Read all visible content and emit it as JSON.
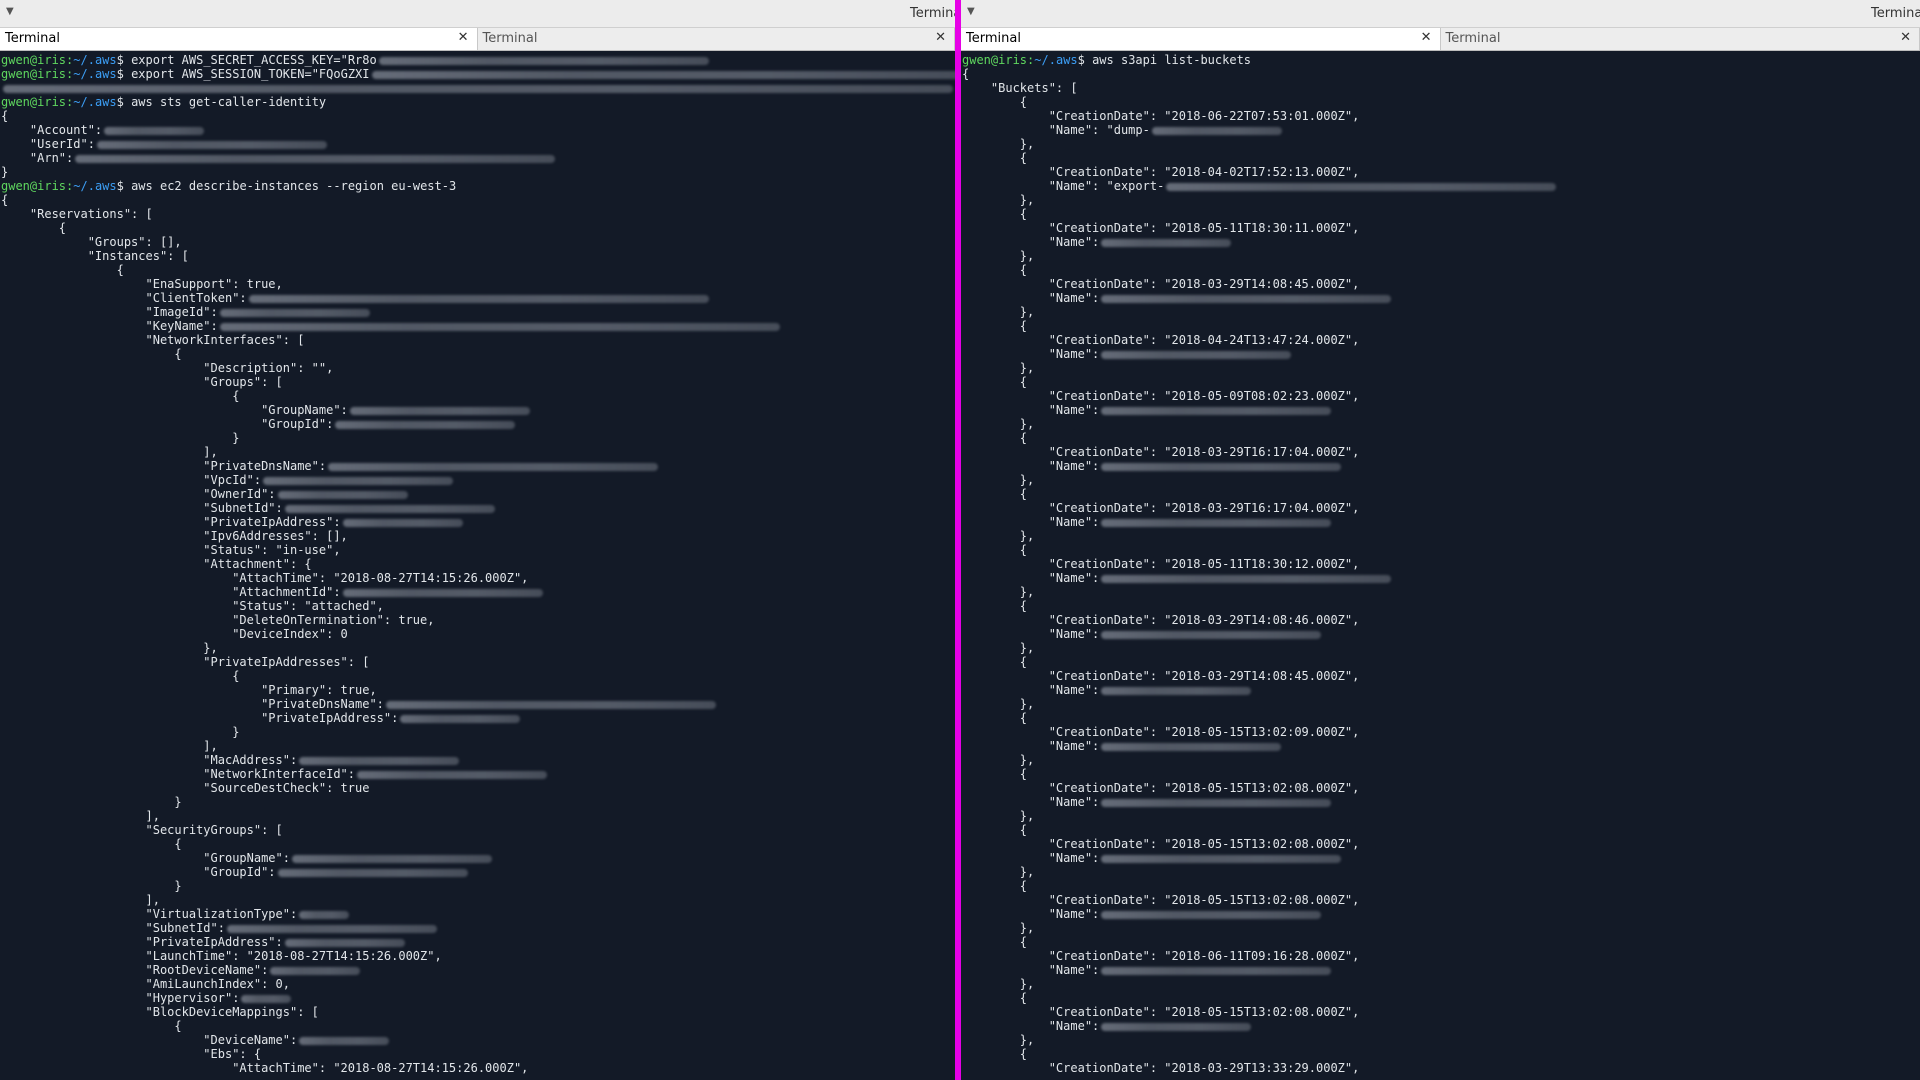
{
  "window": {
    "title": "Terminal"
  },
  "left_pane": {
    "tabs": [
      {
        "label": "Terminal",
        "close": "✕",
        "active": true
      },
      {
        "label": "Terminal",
        "close": "✕",
        "active": false
      }
    ],
    "lines": [
      {
        "kind": "prompt",
        "user": "gwen@iris",
        "path": "~/.aws",
        "cmd": "export AWS_SECRET_ACCESS_KEY=\"Rr8o",
        "blur": 330
      },
      {
        "kind": "prompt",
        "user": "gwen@iris",
        "path": "~/.aws",
        "cmd": "export AWS_SESSION_TOKEN=\"FQoGZXI",
        "blur": 590
      },
      {
        "kind": "text",
        "text": "",
        "blur": 950
      },
      {
        "kind": "prompt",
        "user": "gwen@iris",
        "path": "~/.aws",
        "cmd": "aws sts get-caller-identity"
      },
      {
        "kind": "text",
        "text": "{"
      },
      {
        "kind": "text",
        "text": "    \"Account\":",
        "blur": 100
      },
      {
        "kind": "text",
        "text": "    \"UserId\":",
        "blur": 230
      },
      {
        "kind": "text",
        "text": "    \"Arn\":",
        "blur": 480
      },
      {
        "kind": "text",
        "text": "}"
      },
      {
        "kind": "prompt",
        "user": "gwen@iris",
        "path": "~/.aws",
        "cmd": "aws ec2 describe-instances --region eu-west-3"
      },
      {
        "kind": "text",
        "text": "{"
      },
      {
        "kind": "text",
        "text": "    \"Reservations\": ["
      },
      {
        "kind": "text",
        "text": "        {"
      },
      {
        "kind": "text",
        "text": "            \"Groups\": [],"
      },
      {
        "kind": "text",
        "text": "            \"Instances\": ["
      },
      {
        "kind": "text",
        "text": "                {"
      },
      {
        "kind": "text",
        "text": "                    \"EnaSupport\": true,"
      },
      {
        "kind": "text",
        "text": "                    \"ClientToken\":",
        "blur": 460
      },
      {
        "kind": "text",
        "text": "                    \"ImageId\":",
        "blur": 150
      },
      {
        "kind": "text",
        "text": "                    \"KeyName\":",
        "blur": 560
      },
      {
        "kind": "text",
        "text": "                    \"NetworkInterfaces\": ["
      },
      {
        "kind": "text",
        "text": "                        {"
      },
      {
        "kind": "text",
        "text": "                            \"Description\": \"\","
      },
      {
        "kind": "text",
        "text": "                            \"Groups\": ["
      },
      {
        "kind": "text",
        "text": "                                {"
      },
      {
        "kind": "text",
        "text": "                                    \"GroupName\":",
        "blur": 180
      },
      {
        "kind": "text",
        "text": "                                    \"GroupId\":",
        "blur": 180
      },
      {
        "kind": "text",
        "text": "                                }"
      },
      {
        "kind": "text",
        "text": "                            ],"
      },
      {
        "kind": "text",
        "text": "                            \"PrivateDnsName\":",
        "blur": 330
      },
      {
        "kind": "text",
        "text": "                            \"VpcId\":",
        "blur": 190
      },
      {
        "kind": "text",
        "text": "                            \"OwnerId\":",
        "blur": 130
      },
      {
        "kind": "text",
        "text": "                            \"SubnetId\":",
        "blur": 210
      },
      {
        "kind": "text",
        "text": "                            \"PrivateIpAddress\":",
        "blur": 120
      },
      {
        "kind": "text",
        "text": "                            \"Ipv6Addresses\": [],"
      },
      {
        "kind": "text",
        "text": "                            \"Status\": \"in-use\","
      },
      {
        "kind": "text",
        "text": "                            \"Attachment\": {"
      },
      {
        "kind": "text",
        "text": "                                \"AttachTime\": \"2018-08-27T14:15:26.000Z\","
      },
      {
        "kind": "text",
        "text": "                                \"AttachmentId\":",
        "blur": 200
      },
      {
        "kind": "text",
        "text": "                                \"Status\": \"attached\","
      },
      {
        "kind": "text",
        "text": "                                \"DeleteOnTermination\": true,"
      },
      {
        "kind": "text",
        "text": "                                \"DeviceIndex\": 0"
      },
      {
        "kind": "text",
        "text": "                            },"
      },
      {
        "kind": "text",
        "text": "                            \"PrivateIpAddresses\": ["
      },
      {
        "kind": "text",
        "text": "                                {"
      },
      {
        "kind": "text",
        "text": "                                    \"Primary\": true,"
      },
      {
        "kind": "text",
        "text": "                                    \"PrivateDnsName\":",
        "blur": 330
      },
      {
        "kind": "text",
        "text": "                                    \"PrivateIpAddress\":",
        "blur": 120
      },
      {
        "kind": "text",
        "text": "                                }"
      },
      {
        "kind": "text",
        "text": "                            ],"
      },
      {
        "kind": "text",
        "text": "                            \"MacAddress\":",
        "blur": 160
      },
      {
        "kind": "text",
        "text": "                            \"NetworkInterfaceId\":",
        "blur": 190
      },
      {
        "kind": "text",
        "text": "                            \"SourceDestCheck\": true"
      },
      {
        "kind": "text",
        "text": "                        }"
      },
      {
        "kind": "text",
        "text": "                    ],"
      },
      {
        "kind": "text",
        "text": "                    \"SecurityGroups\": ["
      },
      {
        "kind": "text",
        "text": "                        {"
      },
      {
        "kind": "text",
        "text": "                            \"GroupName\":",
        "blur": 200
      },
      {
        "kind": "text",
        "text": "                            \"GroupId\":",
        "blur": 190
      },
      {
        "kind": "text",
        "text": "                        }"
      },
      {
        "kind": "text",
        "text": "                    ],"
      },
      {
        "kind": "text",
        "text": "                    \"VirtualizationType\":",
        "blur": 50
      },
      {
        "kind": "text",
        "text": "                    \"SubnetId\":",
        "blur": 210
      },
      {
        "kind": "text",
        "text": "                    \"PrivateIpAddress\":",
        "blur": 120
      },
      {
        "kind": "text",
        "text": "                    \"LaunchTime\": \"2018-08-27T14:15:26.000Z\","
      },
      {
        "kind": "text",
        "text": "                    \"RootDeviceName\":",
        "blur": 90
      },
      {
        "kind": "text",
        "text": "                    \"AmiLaunchIndex\": 0,"
      },
      {
        "kind": "text",
        "text": "                    \"Hypervisor\":",
        "blur": 50
      },
      {
        "kind": "text",
        "text": "                    \"BlockDeviceMappings\": ["
      },
      {
        "kind": "text",
        "text": "                        {"
      },
      {
        "kind": "text",
        "text": "                            \"DeviceName\":",
        "blur": 90
      },
      {
        "kind": "text",
        "text": "                            \"Ebs\": {"
      },
      {
        "kind": "text",
        "text": "                                \"AttachTime\": \"2018-08-27T14:15:26.000Z\","
      }
    ]
  },
  "right_pane": {
    "tabs": [
      {
        "label": "Terminal",
        "close": "✕",
        "active": true
      },
      {
        "label": "Terminal",
        "close": "✕",
        "active": false
      }
    ],
    "lines": [
      {
        "kind": "prompt",
        "user": "gwen@iris",
        "path": "~/.aws",
        "cmd": "aws s3api list-buckets"
      },
      {
        "kind": "text",
        "text": "{"
      },
      {
        "kind": "text",
        "text": "    \"Buckets\": ["
      },
      {
        "kind": "text",
        "text": "        {"
      },
      {
        "kind": "text",
        "text": "            \"CreationDate\": \"2018-06-22T07:53:01.000Z\","
      },
      {
        "kind": "text",
        "text": "            \"Name\": \"dump-",
        "blur": 130
      },
      {
        "kind": "text",
        "text": "        },"
      },
      {
        "kind": "text",
        "text": "        {"
      },
      {
        "kind": "text",
        "text": "            \"CreationDate\": \"2018-04-02T17:52:13.000Z\","
      },
      {
        "kind": "text",
        "text": "            \"Name\": \"export-",
        "blur": 390
      },
      {
        "kind": "text",
        "text": "        },"
      },
      {
        "kind": "text",
        "text": "        {"
      },
      {
        "kind": "text",
        "text": "            \"CreationDate\": \"2018-05-11T18:30:11.000Z\","
      },
      {
        "kind": "text",
        "text": "            \"Name\":",
        "blur": 130
      },
      {
        "kind": "text",
        "text": "        },"
      },
      {
        "kind": "text",
        "text": "        {"
      },
      {
        "kind": "text",
        "text": "            \"CreationDate\": \"2018-03-29T14:08:45.000Z\","
      },
      {
        "kind": "text",
        "text": "            \"Name\":",
        "blur": 290
      },
      {
        "kind": "text",
        "text": "        },"
      },
      {
        "kind": "text",
        "text": "        {"
      },
      {
        "kind": "text",
        "text": "            \"CreationDate\": \"2018-04-24T13:47:24.000Z\","
      },
      {
        "kind": "text",
        "text": "            \"Name\":",
        "blur": 190
      },
      {
        "kind": "text",
        "text": "        },"
      },
      {
        "kind": "text",
        "text": "        {"
      },
      {
        "kind": "text",
        "text": "            \"CreationDate\": \"2018-05-09T08:02:23.000Z\","
      },
      {
        "kind": "text",
        "text": "            \"Name\":",
        "blur": 230
      },
      {
        "kind": "text",
        "text": "        },"
      },
      {
        "kind": "text",
        "text": "        {"
      },
      {
        "kind": "text",
        "text": "            \"CreationDate\": \"2018-03-29T16:17:04.000Z\","
      },
      {
        "kind": "text",
        "text": "            \"Name\":",
        "blur": 240
      },
      {
        "kind": "text",
        "text": "        },"
      },
      {
        "kind": "text",
        "text": "        {"
      },
      {
        "kind": "text",
        "text": "            \"CreationDate\": \"2018-03-29T16:17:04.000Z\","
      },
      {
        "kind": "text",
        "text": "            \"Name\":",
        "blur": 230
      },
      {
        "kind": "text",
        "text": "        },"
      },
      {
        "kind": "text",
        "text": "        {"
      },
      {
        "kind": "text",
        "text": "            \"CreationDate\": \"2018-05-11T18:30:12.000Z\","
      },
      {
        "kind": "text",
        "text": "            \"Name\":",
        "blur": 290
      },
      {
        "kind": "text",
        "text": "        },"
      },
      {
        "kind": "text",
        "text": "        {"
      },
      {
        "kind": "text",
        "text": "            \"CreationDate\": \"2018-03-29T14:08:46.000Z\","
      },
      {
        "kind": "text",
        "text": "            \"Name\":",
        "blur": 220
      },
      {
        "kind": "text",
        "text": "        },"
      },
      {
        "kind": "text",
        "text": "        {"
      },
      {
        "kind": "text",
        "text": "            \"CreationDate\": \"2018-03-29T14:08:45.000Z\","
      },
      {
        "kind": "text",
        "text": "            \"Name\":",
        "blur": 150
      },
      {
        "kind": "text",
        "text": "        },"
      },
      {
        "kind": "text",
        "text": "        {"
      },
      {
        "kind": "text",
        "text": "            \"CreationDate\": \"2018-05-15T13:02:09.000Z\","
      },
      {
        "kind": "text",
        "text": "            \"Name\":",
        "blur": 180
      },
      {
        "kind": "text",
        "text": "        },"
      },
      {
        "kind": "text",
        "text": "        {"
      },
      {
        "kind": "text",
        "text": "            \"CreationDate\": \"2018-05-15T13:02:08.000Z\","
      },
      {
        "kind": "text",
        "text": "            \"Name\":",
        "blur": 230
      },
      {
        "kind": "text",
        "text": "        },"
      },
      {
        "kind": "text",
        "text": "        {"
      },
      {
        "kind": "text",
        "text": "            \"CreationDate\": \"2018-05-15T13:02:08.000Z\","
      },
      {
        "kind": "text",
        "text": "            \"Name\":",
        "blur": 240
      },
      {
        "kind": "text",
        "text": "        },"
      },
      {
        "kind": "text",
        "text": "        {"
      },
      {
        "kind": "text",
        "text": "            \"CreationDate\": \"2018-05-15T13:02:08.000Z\","
      },
      {
        "kind": "text",
        "text": "            \"Name\":",
        "blur": 220
      },
      {
        "kind": "text",
        "text": "        },"
      },
      {
        "kind": "text",
        "text": "        {"
      },
      {
        "kind": "text",
        "text": "            \"CreationDate\": \"2018-06-11T09:16:28.000Z\","
      },
      {
        "kind": "text",
        "text": "            \"Name\":",
        "blur": 230
      },
      {
        "kind": "text",
        "text": "        },"
      },
      {
        "kind": "text",
        "text": "        {"
      },
      {
        "kind": "text",
        "text": "            \"CreationDate\": \"2018-05-15T13:02:08.000Z\","
      },
      {
        "kind": "text",
        "text": "            \"Name\":",
        "blur": 150
      },
      {
        "kind": "text",
        "text": "        },"
      },
      {
        "kind": "text",
        "text": "        {"
      },
      {
        "kind": "text",
        "text": "            \"CreationDate\": \"2018-03-29T13:33:29.000Z\","
      }
    ]
  },
  "colors": {
    "background": "#131a27",
    "text": "#e2e6ea",
    "prompt_user": "#5fd75f",
    "prompt_path": "#3c9ef5",
    "divider": "#e600e6"
  }
}
